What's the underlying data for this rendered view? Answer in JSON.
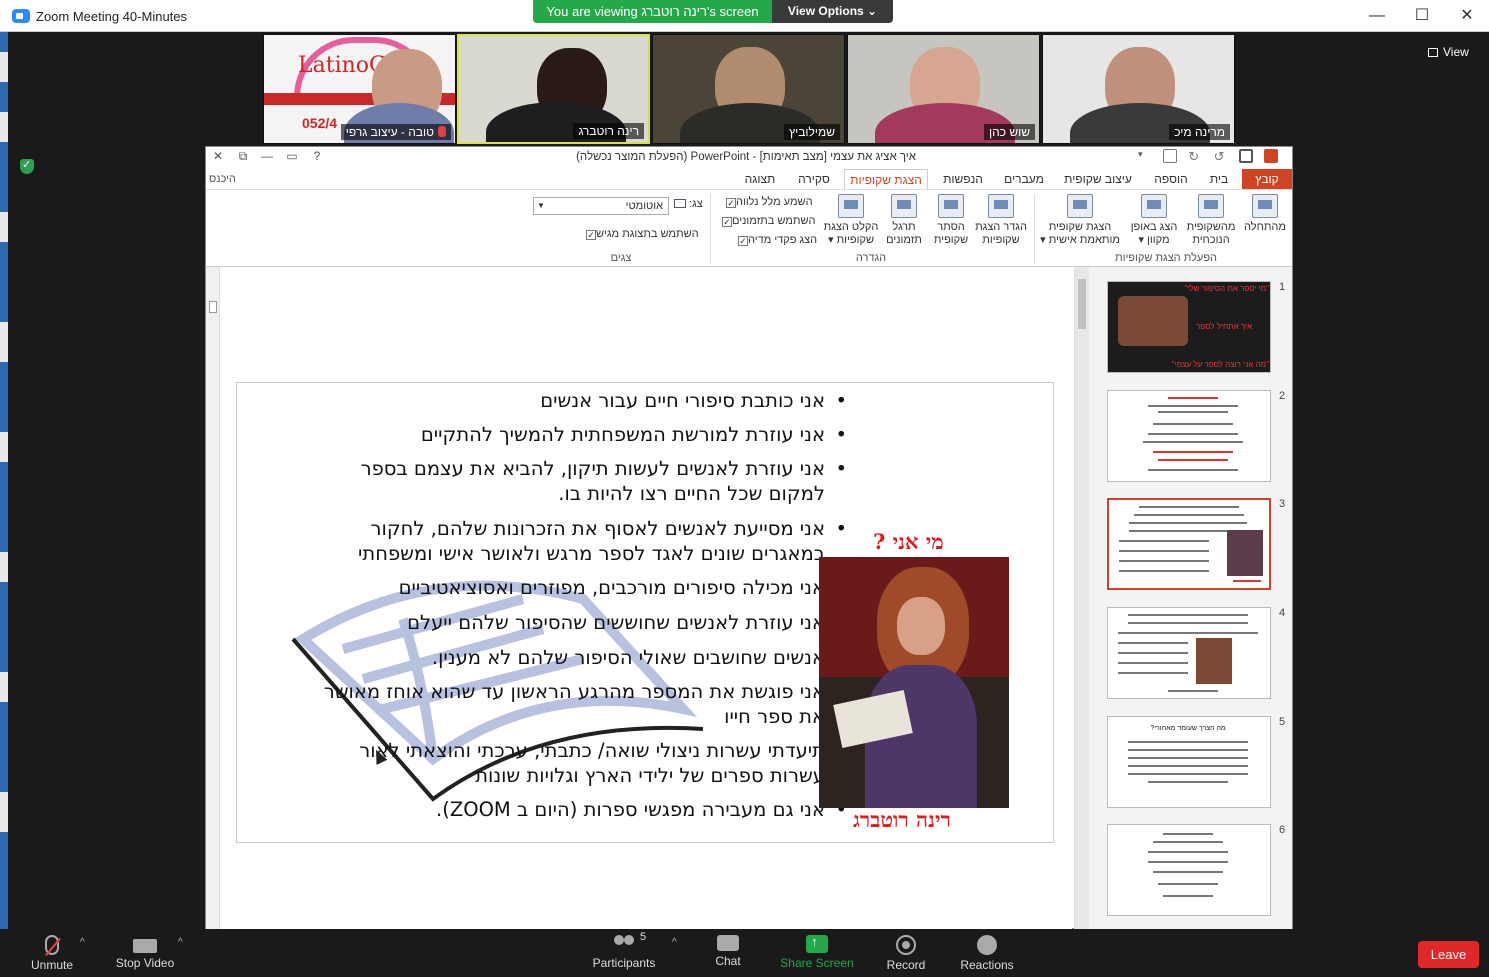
{
  "window": {
    "title": "Zoom Meeting 40-Minutes",
    "controls": {
      "minimize": "—",
      "maximize": "☐",
      "close": "✕"
    }
  },
  "banner": {
    "viewing_text": "You are viewing רינה רוטברג's screen",
    "view_options": "View Options ⌄"
  },
  "view_button": "View",
  "participants": [
    {
      "name": "טובה - עיצוב גרפי",
      "muted": true,
      "logo_text": "LatinoG",
      "logo_number": "052/4"
    },
    {
      "name": "רינה רוטברג",
      "active": true
    },
    {
      "name": "שמילוביץ"
    },
    {
      "name": "שוש כהן"
    },
    {
      "name": "מרינה מיכ"
    }
  ],
  "ppt": {
    "title": "איך אציג את עצמי [מצב תאימות] - PowerPoint (הפעלת המוצר נכשלה)",
    "help": "?",
    "sign_in": "היכנס",
    "tabs": [
      "קובץ",
      "בית",
      "הוספה",
      "עיצוב שקופית",
      "מעברים",
      "הנפשות",
      "הצגת שקופיות",
      "סקירה",
      "תצוגה"
    ],
    "active_tab": "הצגת שקופיות",
    "ribbon": {
      "buttons": [
        {
          "label": "מהתחלה"
        },
        {
          "label": "מהשקופית הנוכחית"
        },
        {
          "label": "הצג באופן מקוון ▾"
        },
        {
          "label": "הצגת שקופית מותאמת אישית ▾"
        },
        {
          "label": "הגדר הצגת שקופיות"
        },
        {
          "label": "הסתר שקופית"
        },
        {
          "label": "תרגל תזמונים"
        },
        {
          "label": "הקלט הצגת שקופיות ▾"
        }
      ],
      "checkboxes": [
        {
          "label": "השמע מלל נלווה",
          "checked": true
        },
        {
          "label": "השתמש בתזמונים",
          "checked": true
        },
        {
          "label": "הצג פקדי מדיה",
          "checked": true
        },
        {
          "label": "השתמש בתצוגת מגיש",
          "checked": true
        }
      ],
      "screen_label": "צג:",
      "screen_value": "אוטומטי",
      "groups": [
        "הפעלת הצגת שקופיות",
        "הגדרה",
        "צגים"
      ]
    }
  },
  "slide": {
    "title": "מי אני ?",
    "name_caption": "רינה רוטברג",
    "bullets": [
      {
        "text": "אני כותבת סיפורי חיים עבור אנשים",
        "bullet": true
      },
      {
        "text": "אני עוזרת למורשת המשפחתית להמשיך להתקיים",
        "bullet": true
      },
      {
        "text": "אני עוזרת לאנשים לעשות תיקון, להביא את עצמם בספר",
        "bullet": true
      },
      {
        "text": "למקום שכל החיים רצו להיות בו.",
        "bullet": false
      },
      {
        "text": "אני מסייעת לאנשים לאסוף את הזכרונות שלהם, לחקור",
        "bullet": true
      },
      {
        "text": "במאגרים שונים לאגד לספר מרגש ולאושר אישי ומשפחתי",
        "bullet": false
      },
      {
        "text": "אני מכילה סיפורים מורכבים, מפוזרים ואסוציאטיביים",
        "bullet": true
      },
      {
        "text": "אני עוזרת לאנשים שחוששים שהסיפור שלהם ייעלם",
        "bullet": true
      },
      {
        "text": "אנשים שחושבים שאולי הסיפור שלהם לא מענין.",
        "bullet": true
      },
      {
        "text": "אני פוגשת את המספר מהרגע הראשון עד שהוא אוחז מאושר",
        "bullet": true
      },
      {
        "text": "את ספר חייו",
        "bullet": false
      },
      {
        "text": "תיעדתי עשרות ניצולי שואה/ כתבתי, ערכתי והוצאתי לאור",
        "bullet": true
      },
      {
        "text": "עשרות ספרים של ילידי הארץ וגלויות שונות",
        "bullet": false
      },
      {
        "text": "אני גם מעבירה מפגשי ספרות (היום ב ZOOM).",
        "bullet": true
      }
    ]
  },
  "thumbnails": {
    "numbers": [
      "1",
      "2",
      "3",
      "4",
      "5",
      "6"
    ],
    "selected": 3,
    "slide1": {
      "top": "\"מי יספר את הסיפור שלי\"",
      "mid": "איך אתחיל לספר",
      "bottom": "\"מה אני רוצה לספר על עצמי\""
    },
    "slide5_title": "מה הצרך שעומד מאחורי?"
  },
  "toolbar": {
    "unmute": "Unmute",
    "stop_video": "Stop Video",
    "participants": "Participants",
    "participant_count": "5",
    "chat": "Chat",
    "share_screen": "Share Screen",
    "record": "Record",
    "reactions": "Reactions",
    "leave": "Leave",
    "caret": "^"
  },
  "colors": {
    "zoom_green": "#23a94a",
    "ppt_accent": "#d04423",
    "leave_red": "#e02828",
    "slide_red": "#e01b1b"
  }
}
